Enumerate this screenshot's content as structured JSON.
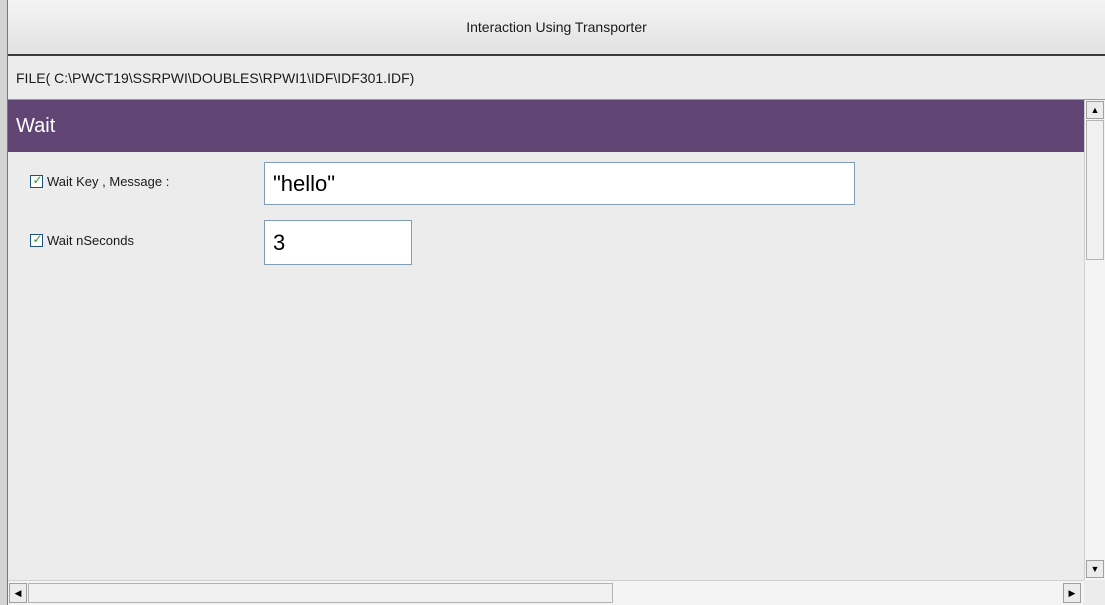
{
  "window": {
    "title": "Interaction Using Transporter"
  },
  "file_bar": {
    "path": "FILE( C:\\PWCT19\\SSRPWI\\DOUBLES\\RPWI1\\IDF\\IDF301.IDF)"
  },
  "section": {
    "title": "Wait",
    "header_color": "#614575"
  },
  "fields": [
    {
      "label": "Wait Key , Message :",
      "checked": true,
      "value": "\"hello\""
    },
    {
      "label": "Wait nSeconds",
      "checked": true,
      "value": "3"
    }
  ],
  "icons": {
    "checkbox_tick": "✓",
    "scroll_up": "▲",
    "scroll_down": "▼",
    "scroll_left": "◀",
    "scroll_right": "▶"
  },
  "colors": {
    "check_tick": "#21a121",
    "background": "#ececec"
  }
}
